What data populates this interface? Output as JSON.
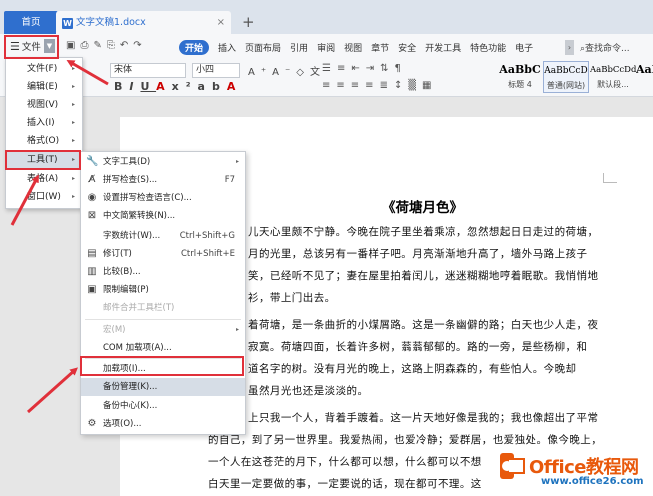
{
  "titlebar": {
    "home_tab": "首页",
    "doc_tab": "文字文稿1.docx",
    "doc_icon": "W",
    "close": "×",
    "add": "+"
  },
  "ribbon": {
    "file_label": "文件",
    "tabs": [
      "开始",
      "插入",
      "页面布局",
      "引用",
      "审阅",
      "视图",
      "章节",
      "安全",
      "开发工具",
      "特色功能",
      "电子"
    ],
    "search": "查找命令...",
    "font_name": "宋体",
    "font_size": "小四",
    "styles": [
      {
        "sample": "AaBbC",
        "name": "标题 4"
      },
      {
        "sample": "AaBbCcD",
        "name": "普通(网站)"
      },
      {
        "sample": "AaBbCcDd",
        "name": "默认段..."
      },
      {
        "sample": "AaBb",
        "name": ""
      }
    ]
  },
  "file_menu": {
    "items": [
      {
        "label": "文件(F)",
        "arrow": "▸"
      },
      {
        "label": "编辑(E)",
        "arrow": "▸"
      },
      {
        "label": "视图(V)",
        "arrow": "▸"
      },
      {
        "label": "插入(I)",
        "arrow": "▸"
      },
      {
        "label": "格式(O)",
        "arrow": "▸"
      },
      {
        "label": "工具(T)",
        "arrow": "▸"
      },
      {
        "label": "表格(A)",
        "arrow": "▸"
      },
      {
        "label": "窗口(W)",
        "arrow": "▸"
      }
    ]
  },
  "tools_menu": {
    "items": [
      {
        "label": "文字工具(D)",
        "shortcut": "",
        "icon": "wrench-icon"
      },
      {
        "label": "拼写检查(S)...",
        "shortcut": "F7",
        "icon": "spellcheck-icon"
      },
      {
        "label": "设置拼写检查语言(C)...",
        "shortcut": "",
        "icon": "globe-icon"
      },
      {
        "label": "中文简繁转换(N)...",
        "shortcut": "",
        "icon": "convert-icon"
      },
      {
        "label": "字数统计(W)...",
        "shortcut": "Ctrl+Shift+G",
        "icon": ""
      },
      {
        "label": "修订(T)",
        "shortcut": "Ctrl+Shift+E",
        "icon": "revise-icon"
      },
      {
        "label": "比较(B)...",
        "shortcut": "",
        "icon": "compare-icon"
      },
      {
        "label": "限制编辑(P)",
        "shortcut": "",
        "icon": "lock-icon"
      },
      {
        "label": "邮件合并工具栏(T)",
        "shortcut": "",
        "icon": ""
      },
      {
        "label": "宏(M)",
        "shortcut": "",
        "icon": ""
      },
      {
        "label": "COM 加载项(A)...",
        "shortcut": "",
        "icon": ""
      },
      {
        "label": "加载项(I)...",
        "shortcut": "",
        "icon": ""
      },
      {
        "label": "备份管理(K)...",
        "shortcut": "",
        "icon": ""
      },
      {
        "label": "备份中心(K)...",
        "shortcut": "",
        "icon": ""
      },
      {
        "label": "选项(O)...",
        "shortcut": "",
        "icon": "gear-icon"
      }
    ]
  },
  "document": {
    "title": "《荷塘月色》",
    "lines": [
      "儿天心里颇不宁静。今晚在院子里坐着乘凉，忽然想起日日走过的荷塘，",
      "月的光里，总该另有一番样子吧。月亮渐渐地升高了，墙外马路上孩子",
      "笑，已经听不见了；妻在屋里拍着闰儿，迷迷糊糊地哼着眠歌。我悄悄地",
      "衫，带上门出去。",
      "着荷塘，是一条曲折的小煤屑路。这是一条幽僻的路；白天也少人走，夜",
      "寂寞。荷塘四面，长着许多树，蓊蓊郁郁的。路的一旁，是些杨柳，和",
      "道名字的树。没有月光的晚上，这路上阴森森的，有些怕人。今晚却",
      "虽然月光也还是淡淡的。",
      "上只我一个人，背着手踱着。这一片天地好像是我的；我也像超出了平常",
      "的自己，到了另一世界里。我爱热闹，也爱冷静；爱群居，也爱独处。像今晚上，",
      "一个人在这苍茫的月下，什么都可以想，什么都可以不想",
      "白天里一定要做的事，一定要说的话，现在都可不理。这"
    ]
  },
  "watermark": {
    "title": "Office教程网",
    "url": "www.office26.com"
  },
  "colors": {
    "accent": "#2f6fce",
    "highlight_box": "#e0303a",
    "watermark_orange": "#e8590c"
  }
}
